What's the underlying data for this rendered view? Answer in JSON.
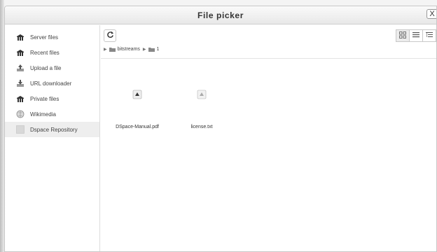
{
  "dialog": {
    "title": "File picker",
    "close_label": "X"
  },
  "sidebar": {
    "items": [
      {
        "label": "Server files",
        "icon": "server-icon"
      },
      {
        "label": "Recent files",
        "icon": "recent-icon"
      },
      {
        "label": "Upload a file",
        "icon": "upload-icon"
      },
      {
        "label": "URL downloader",
        "icon": "url-download-icon"
      },
      {
        "label": "Private files",
        "icon": "private-files-icon"
      },
      {
        "label": "Wikimedia",
        "icon": "wikimedia-icon"
      },
      {
        "label": "Dspace Repository",
        "icon": "dspace-icon",
        "active": true
      }
    ]
  },
  "toolbar": {
    "refresh_icon": "refresh-icon",
    "views": [
      "icons-view-icon",
      "list-view-icon",
      "tree-view-icon"
    ],
    "selected_view": "icons-view-icon"
  },
  "breadcrumb": {
    "items": [
      "bitstreams",
      "1"
    ]
  },
  "files": [
    {
      "name": "DSpace-Manual.pdf",
      "icon": "pdf-file-icon"
    },
    {
      "name": "license.txt",
      "icon": "text-file-icon"
    }
  ],
  "colors": {
    "accent": "#e8e8e8",
    "border": "#c8c8c8",
    "active_item": "#eeeeee"
  }
}
